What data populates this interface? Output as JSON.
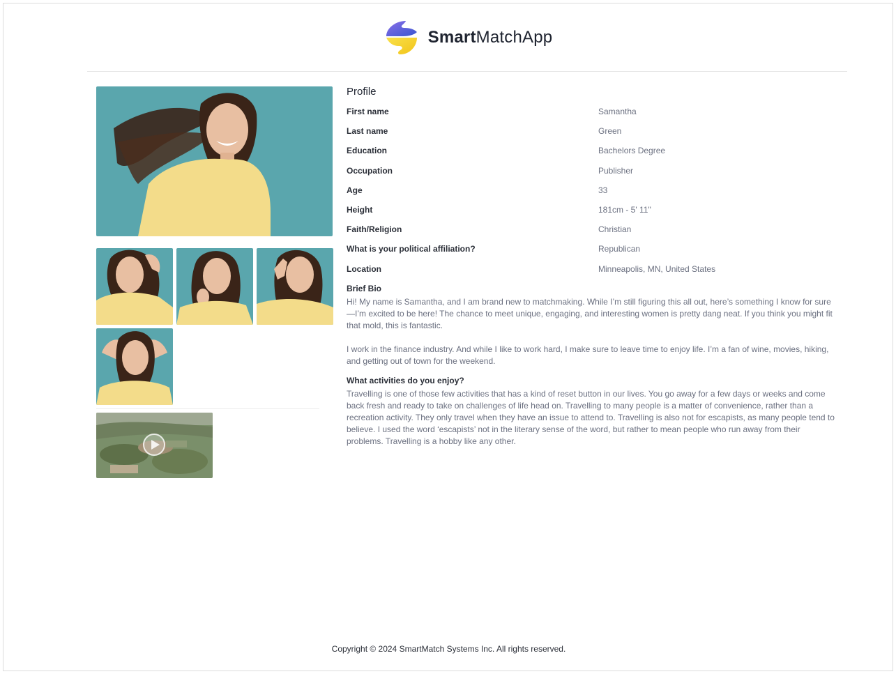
{
  "brand": {
    "name_bold": "Smart",
    "name_light": "MatchApp"
  },
  "profile": {
    "title": "Profile",
    "fields": [
      {
        "label": "First name",
        "value": "Samantha"
      },
      {
        "label": "Last name",
        "value": "Green"
      },
      {
        "label": "Education",
        "value": "Bachelors Degree"
      },
      {
        "label": "Occupation",
        "value": "Publisher"
      },
      {
        "label": "Age",
        "value": "33"
      },
      {
        "label": "Height",
        "value": "181cm - 5' 11\""
      },
      {
        "label": "Faith/Religion",
        "value": "Christian"
      },
      {
        "label": "What is your political affiliation?",
        "value": "Republican"
      },
      {
        "label": "Location",
        "value": "Minneapolis, MN, United States"
      }
    ],
    "bio": {
      "title": "Brief Bio",
      "text": "Hi! My name is Samantha, and I am brand new to matchmaking. While I’m still figuring this all out, here’s something I know for sure—I’m excited to be here! The chance to meet unique, engaging, and interesting women is pretty dang neat. If you think you might fit that mold, this is fantastic.\n\nI work in the finance industry. And while I like to work hard, I make sure to leave time to enjoy life. I’m a fan of wine, movies, hiking, and getting out of town for the weekend."
    },
    "activities": {
      "title": "What activities do you enjoy?",
      "text": "Travelling is one of those few activities that has a kind of reset button in our lives. You go away for a few days or weeks and come back fresh and ready to take on challenges of life head on. Travelling to many people is a matter of convenience, rather than a recreation activity. They only travel when they have an issue to attend to. Travelling is also not for escapists, as many people tend to believe. I used the word ‘escapists’ not in the literary sense of the word, but rather to mean people who run away from their problems. Travelling is a hobby like any other."
    }
  },
  "footer": {
    "text": "Copyright © 2024 SmartMatch Systems Inc. All rights reserved."
  },
  "colors": {
    "photo_bg": "#5aa6ad",
    "shirt": "#f3dc8a",
    "hair": "#3a2418",
    "skin": "#e8bfa2",
    "brand_blue": "#4a5fd6",
    "brand_yellow": "#f5d430"
  },
  "icons": {
    "logo": "smartmatch-logo-icon",
    "play": "play-icon"
  }
}
